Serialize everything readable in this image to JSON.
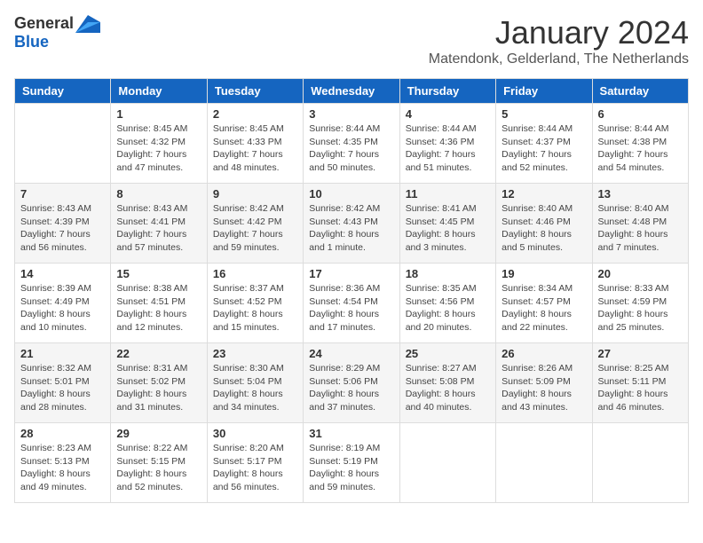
{
  "logo": {
    "general": "General",
    "blue": "Blue"
  },
  "title": {
    "month": "January 2024",
    "location": "Matendonk, Gelderland, The Netherlands"
  },
  "headers": [
    "Sunday",
    "Monday",
    "Tuesday",
    "Wednesday",
    "Thursday",
    "Friday",
    "Saturday"
  ],
  "weeks": [
    [
      {
        "day": "",
        "sunrise": "",
        "sunset": "",
        "daylight": ""
      },
      {
        "day": "1",
        "sunrise": "Sunrise: 8:45 AM",
        "sunset": "Sunset: 4:32 PM",
        "daylight": "Daylight: 7 hours and 47 minutes."
      },
      {
        "day": "2",
        "sunrise": "Sunrise: 8:45 AM",
        "sunset": "Sunset: 4:33 PM",
        "daylight": "Daylight: 7 hours and 48 minutes."
      },
      {
        "day": "3",
        "sunrise": "Sunrise: 8:44 AM",
        "sunset": "Sunset: 4:35 PM",
        "daylight": "Daylight: 7 hours and 50 minutes."
      },
      {
        "day": "4",
        "sunrise": "Sunrise: 8:44 AM",
        "sunset": "Sunset: 4:36 PM",
        "daylight": "Daylight: 7 hours and 51 minutes."
      },
      {
        "day": "5",
        "sunrise": "Sunrise: 8:44 AM",
        "sunset": "Sunset: 4:37 PM",
        "daylight": "Daylight: 7 hours and 52 minutes."
      },
      {
        "day": "6",
        "sunrise": "Sunrise: 8:44 AM",
        "sunset": "Sunset: 4:38 PM",
        "daylight": "Daylight: 7 hours and 54 minutes."
      }
    ],
    [
      {
        "day": "7",
        "sunrise": "Sunrise: 8:43 AM",
        "sunset": "Sunset: 4:39 PM",
        "daylight": "Daylight: 7 hours and 56 minutes."
      },
      {
        "day": "8",
        "sunrise": "Sunrise: 8:43 AM",
        "sunset": "Sunset: 4:41 PM",
        "daylight": "Daylight: 7 hours and 57 minutes."
      },
      {
        "day": "9",
        "sunrise": "Sunrise: 8:42 AM",
        "sunset": "Sunset: 4:42 PM",
        "daylight": "Daylight: 7 hours and 59 minutes."
      },
      {
        "day": "10",
        "sunrise": "Sunrise: 8:42 AM",
        "sunset": "Sunset: 4:43 PM",
        "daylight": "Daylight: 8 hours and 1 minute."
      },
      {
        "day": "11",
        "sunrise": "Sunrise: 8:41 AM",
        "sunset": "Sunset: 4:45 PM",
        "daylight": "Daylight: 8 hours and 3 minutes."
      },
      {
        "day": "12",
        "sunrise": "Sunrise: 8:40 AM",
        "sunset": "Sunset: 4:46 PM",
        "daylight": "Daylight: 8 hours and 5 minutes."
      },
      {
        "day": "13",
        "sunrise": "Sunrise: 8:40 AM",
        "sunset": "Sunset: 4:48 PM",
        "daylight": "Daylight: 8 hours and 7 minutes."
      }
    ],
    [
      {
        "day": "14",
        "sunrise": "Sunrise: 8:39 AM",
        "sunset": "Sunset: 4:49 PM",
        "daylight": "Daylight: 8 hours and 10 minutes."
      },
      {
        "day": "15",
        "sunrise": "Sunrise: 8:38 AM",
        "sunset": "Sunset: 4:51 PM",
        "daylight": "Daylight: 8 hours and 12 minutes."
      },
      {
        "day": "16",
        "sunrise": "Sunrise: 8:37 AM",
        "sunset": "Sunset: 4:52 PM",
        "daylight": "Daylight: 8 hours and 15 minutes."
      },
      {
        "day": "17",
        "sunrise": "Sunrise: 8:36 AM",
        "sunset": "Sunset: 4:54 PM",
        "daylight": "Daylight: 8 hours and 17 minutes."
      },
      {
        "day": "18",
        "sunrise": "Sunrise: 8:35 AM",
        "sunset": "Sunset: 4:56 PM",
        "daylight": "Daylight: 8 hours and 20 minutes."
      },
      {
        "day": "19",
        "sunrise": "Sunrise: 8:34 AM",
        "sunset": "Sunset: 4:57 PM",
        "daylight": "Daylight: 8 hours and 22 minutes."
      },
      {
        "day": "20",
        "sunrise": "Sunrise: 8:33 AM",
        "sunset": "Sunset: 4:59 PM",
        "daylight": "Daylight: 8 hours and 25 minutes."
      }
    ],
    [
      {
        "day": "21",
        "sunrise": "Sunrise: 8:32 AM",
        "sunset": "Sunset: 5:01 PM",
        "daylight": "Daylight: 8 hours and 28 minutes."
      },
      {
        "day": "22",
        "sunrise": "Sunrise: 8:31 AM",
        "sunset": "Sunset: 5:02 PM",
        "daylight": "Daylight: 8 hours and 31 minutes."
      },
      {
        "day": "23",
        "sunrise": "Sunrise: 8:30 AM",
        "sunset": "Sunset: 5:04 PM",
        "daylight": "Daylight: 8 hours and 34 minutes."
      },
      {
        "day": "24",
        "sunrise": "Sunrise: 8:29 AM",
        "sunset": "Sunset: 5:06 PM",
        "daylight": "Daylight: 8 hours and 37 minutes."
      },
      {
        "day": "25",
        "sunrise": "Sunrise: 8:27 AM",
        "sunset": "Sunset: 5:08 PM",
        "daylight": "Daylight: 8 hours and 40 minutes."
      },
      {
        "day": "26",
        "sunrise": "Sunrise: 8:26 AM",
        "sunset": "Sunset: 5:09 PM",
        "daylight": "Daylight: 8 hours and 43 minutes."
      },
      {
        "day": "27",
        "sunrise": "Sunrise: 8:25 AM",
        "sunset": "Sunset: 5:11 PM",
        "daylight": "Daylight: 8 hours and 46 minutes."
      }
    ],
    [
      {
        "day": "28",
        "sunrise": "Sunrise: 8:23 AM",
        "sunset": "Sunset: 5:13 PM",
        "daylight": "Daylight: 8 hours and 49 minutes."
      },
      {
        "day": "29",
        "sunrise": "Sunrise: 8:22 AM",
        "sunset": "Sunset: 5:15 PM",
        "daylight": "Daylight: 8 hours and 52 minutes."
      },
      {
        "day": "30",
        "sunrise": "Sunrise: 8:20 AM",
        "sunset": "Sunset: 5:17 PM",
        "daylight": "Daylight: 8 hours and 56 minutes."
      },
      {
        "day": "31",
        "sunrise": "Sunrise: 8:19 AM",
        "sunset": "Sunset: 5:19 PM",
        "daylight": "Daylight: 8 hours and 59 minutes."
      },
      {
        "day": "",
        "sunrise": "",
        "sunset": "",
        "daylight": ""
      },
      {
        "day": "",
        "sunrise": "",
        "sunset": "",
        "daylight": ""
      },
      {
        "day": "",
        "sunrise": "",
        "sunset": "",
        "daylight": ""
      }
    ]
  ]
}
